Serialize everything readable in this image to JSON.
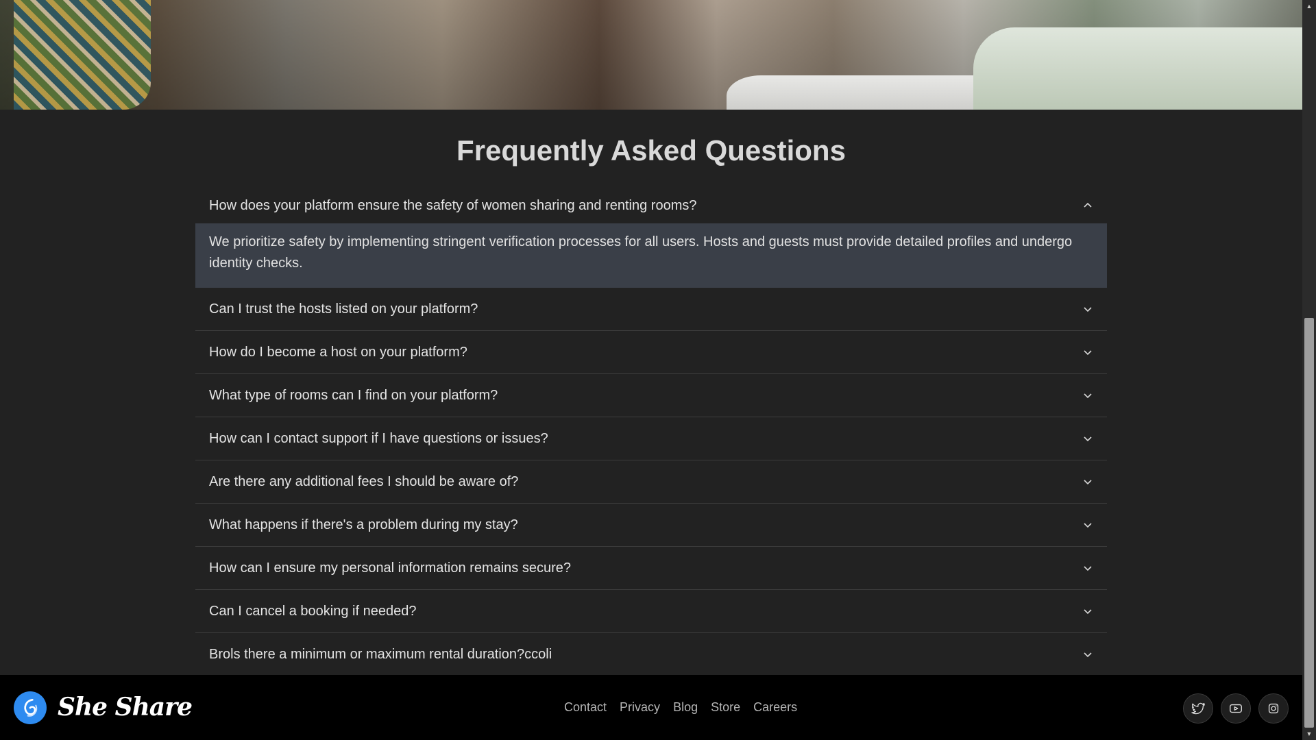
{
  "faq": {
    "title": "Frequently Asked Questions",
    "items": [
      {
        "question": "How does your platform ensure the safety of women sharing and renting rooms?",
        "answer": "We prioritize safety by implementing stringent verification processes for all users. Hosts and guests must provide detailed profiles and undergo identity checks.",
        "expanded": true
      },
      {
        "question": "Can I trust the hosts listed on your platform?",
        "expanded": false
      },
      {
        "question": "How do I become a host on your platform?",
        "expanded": false
      },
      {
        "question": "What type of rooms can I find on your platform?",
        "expanded": false
      },
      {
        "question": "How can I contact support if I have questions or issues?",
        "expanded": false
      },
      {
        "question": "Are there any additional fees I should be aware of?",
        "expanded": false
      },
      {
        "question": "What happens if there's a problem during my stay?",
        "expanded": false
      },
      {
        "question": "How can I ensure my personal information remains secure?",
        "expanded": false
      },
      {
        "question": "Can I cancel a booking if needed?",
        "expanded": false
      },
      {
        "question": "Brols there a minimum or maximum rental duration?ccoli",
        "expanded": false
      }
    ]
  },
  "footer": {
    "brand": "She Share",
    "logo_icon": "swirl-logo-icon",
    "nav": [
      "Contact",
      "Privacy",
      "Blog",
      "Store",
      "Careers"
    ],
    "social_icons": [
      "twitter-icon",
      "youtube-icon",
      "instagram-icon"
    ]
  },
  "colors": {
    "background": "#222222",
    "answer_panel": "#3a3f48",
    "footer": "#000000",
    "brand_blue": "#2e8bf0"
  }
}
